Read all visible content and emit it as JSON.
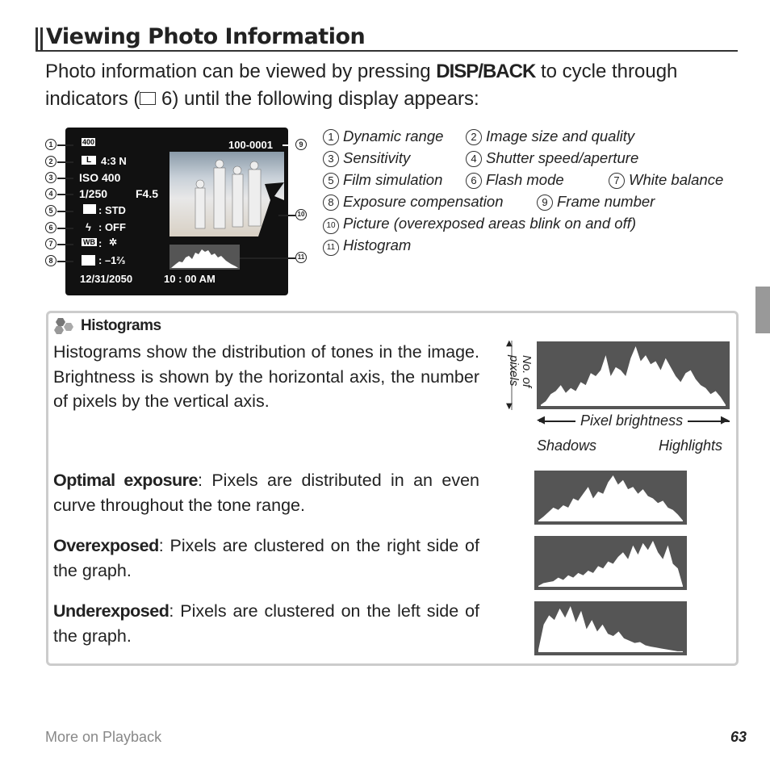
{
  "header": {
    "title": "Viewing Photo Information"
  },
  "intro": {
    "before": "Photo information can be viewed by pressing ",
    "button": "DISP/BACK",
    "after": " to cycle through indicators (",
    "ref_icon": "book-icon",
    "ref": " 6) until the following display appears:"
  },
  "screen": {
    "dynamic_range": "400",
    "size": "4:3 N",
    "size_badge": "L",
    "iso": "ISO 400",
    "shutter": "1/250",
    "aperture": "F4.5",
    "film": ": STD",
    "flash": ": OFF",
    "wb_badge": "WB",
    "wb": ":",
    "exposure": ": –1⅔",
    "frame": "100-0001",
    "date": "12/31/2050",
    "time": "10 : 00  AM"
  },
  "legend": [
    {
      "n": "1",
      "label": "Dynamic range"
    },
    {
      "n": "2",
      "label": "Image size and quality"
    },
    {
      "n": "3",
      "label": "Sensitivity"
    },
    {
      "n": "4",
      "label": "Shutter speed/aperture"
    },
    {
      "n": "5",
      "label": "Film simulation"
    },
    {
      "n": "6",
      "label": "Flash mode"
    },
    {
      "n": "7",
      "label": "White balance"
    },
    {
      "n": "8",
      "label": "Exposure compensation"
    },
    {
      "n": "9",
      "label": "Frame number"
    },
    {
      "n": "10",
      "label": "Picture (overexposed areas blink on and off)"
    },
    {
      "n": "11",
      "label": "Histogram"
    }
  ],
  "histograms": {
    "heading": "Histograms",
    "description": "Histograms show the distribution of tones in the image. Brightness is shown by the horizontal axis, the number of pixels by the vertical axis.",
    "y_axis": "No. of pixels",
    "x_axis": "Pixel brightness",
    "left": "Shadows",
    "right": "Highlights",
    "cases": [
      {
        "term": "Optimal exposure",
        "text": ": Pixels are distributed in an even curve throughout the tone range."
      },
      {
        "term": "Overexposed",
        "text": ": Pixels are clustered on the right side of the graph."
      },
      {
        "term": "Underexposed",
        "text": ": Pixels are clustered on the left side of the graph."
      }
    ]
  },
  "footer": {
    "section": "More on Playback",
    "page": "63"
  }
}
